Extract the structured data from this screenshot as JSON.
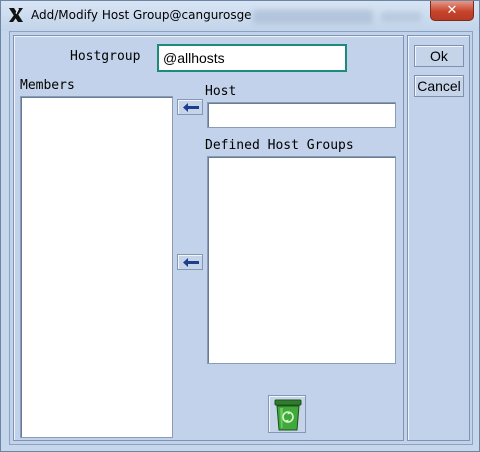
{
  "window": {
    "title": "Add/Modify Host Group@cangurosge",
    "close_label": "✕"
  },
  "form": {
    "hostgroup_label": "Hostgroup",
    "hostgroup_value": "@allhosts",
    "members_label": "Members",
    "members": [],
    "host_label": "Host",
    "host_value": "",
    "defined_groups_label": "Defined Host Groups",
    "defined_groups": []
  },
  "buttons": {
    "ok_label": "Ok",
    "cancel_label": "Cancel"
  },
  "icons": {
    "add_host_arrow": "left-arrow-icon",
    "add_group_arrow": "left-arrow-icon",
    "delete": "trash-icon",
    "app": "x-logo-icon"
  },
  "colors": {
    "focus_border": "#1f8a79",
    "panel_bg": "#c2d2eb",
    "arrow": "#1d3e8c",
    "trash_green": "#3faa3a"
  }
}
